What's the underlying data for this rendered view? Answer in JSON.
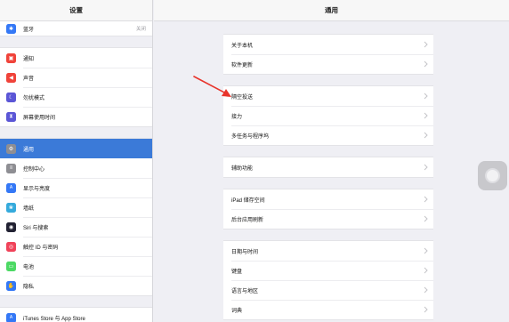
{
  "sidebar": {
    "title": "设置",
    "group1": [
      {
        "label": "蓝牙",
        "value": "关闭",
        "icon": "bluetooth-icon",
        "color": "#3478f6",
        "glyph": "✱"
      }
    ],
    "group2": [
      {
        "label": "通知",
        "icon": "notifications-icon",
        "color": "#f0433a",
        "glyph": "▣"
      },
      {
        "label": "声音",
        "icon": "sound-icon",
        "color": "#f0433a",
        "glyph": "◀"
      },
      {
        "label": "勿扰模式",
        "icon": "moon-icon",
        "color": "#5b56d6",
        "glyph": "☾"
      },
      {
        "label": "屏幕使用时间",
        "icon": "hourglass-icon",
        "color": "#5b56d6",
        "glyph": "⧗"
      }
    ],
    "group3": [
      {
        "label": "通用",
        "icon": "gear-icon",
        "color": "#8e8e93",
        "glyph": "⚙",
        "selected": true
      },
      {
        "label": "控制中心",
        "icon": "control-center-icon",
        "color": "#8e8e93",
        "glyph": "≡"
      },
      {
        "label": "显示与亮度",
        "icon": "display-icon",
        "color": "#3478f6",
        "glyph": "A"
      },
      {
        "label": "墙纸",
        "icon": "wallpaper-icon",
        "color": "#35aadc",
        "glyph": "❀"
      },
      {
        "label": "Siri 与搜索",
        "icon": "siri-icon",
        "color": "#222233",
        "glyph": "◉"
      },
      {
        "label": "触控 ID 与密码",
        "icon": "fingerprint-icon",
        "color": "#f0435a",
        "glyph": "◎"
      },
      {
        "label": "电池",
        "icon": "battery-icon",
        "color": "#4cd964",
        "glyph": "▭"
      },
      {
        "label": "隐私",
        "icon": "privacy-hand-icon",
        "color": "#3478f6",
        "glyph": "✋"
      }
    ],
    "group4": [
      {
        "label": "iTunes Store 与 App Store",
        "icon": "app-store-icon",
        "color": "#3478f6",
        "glyph": "A"
      }
    ]
  },
  "main": {
    "title": "通用",
    "groups": [
      [
        "关于本机",
        "软件更新"
      ],
      [
        "隔空投送",
        "接力",
        "多任务与程序坞"
      ],
      [
        "辅助功能"
      ],
      [
        "iPad 储存空间",
        "后台应用刷新"
      ],
      [
        "日期与时间",
        "键盘",
        "语言与地区",
        "词典"
      ]
    ]
  },
  "colors": {
    "accent": "#3b7ad8",
    "annotation_arrow": "#e8342b"
  }
}
